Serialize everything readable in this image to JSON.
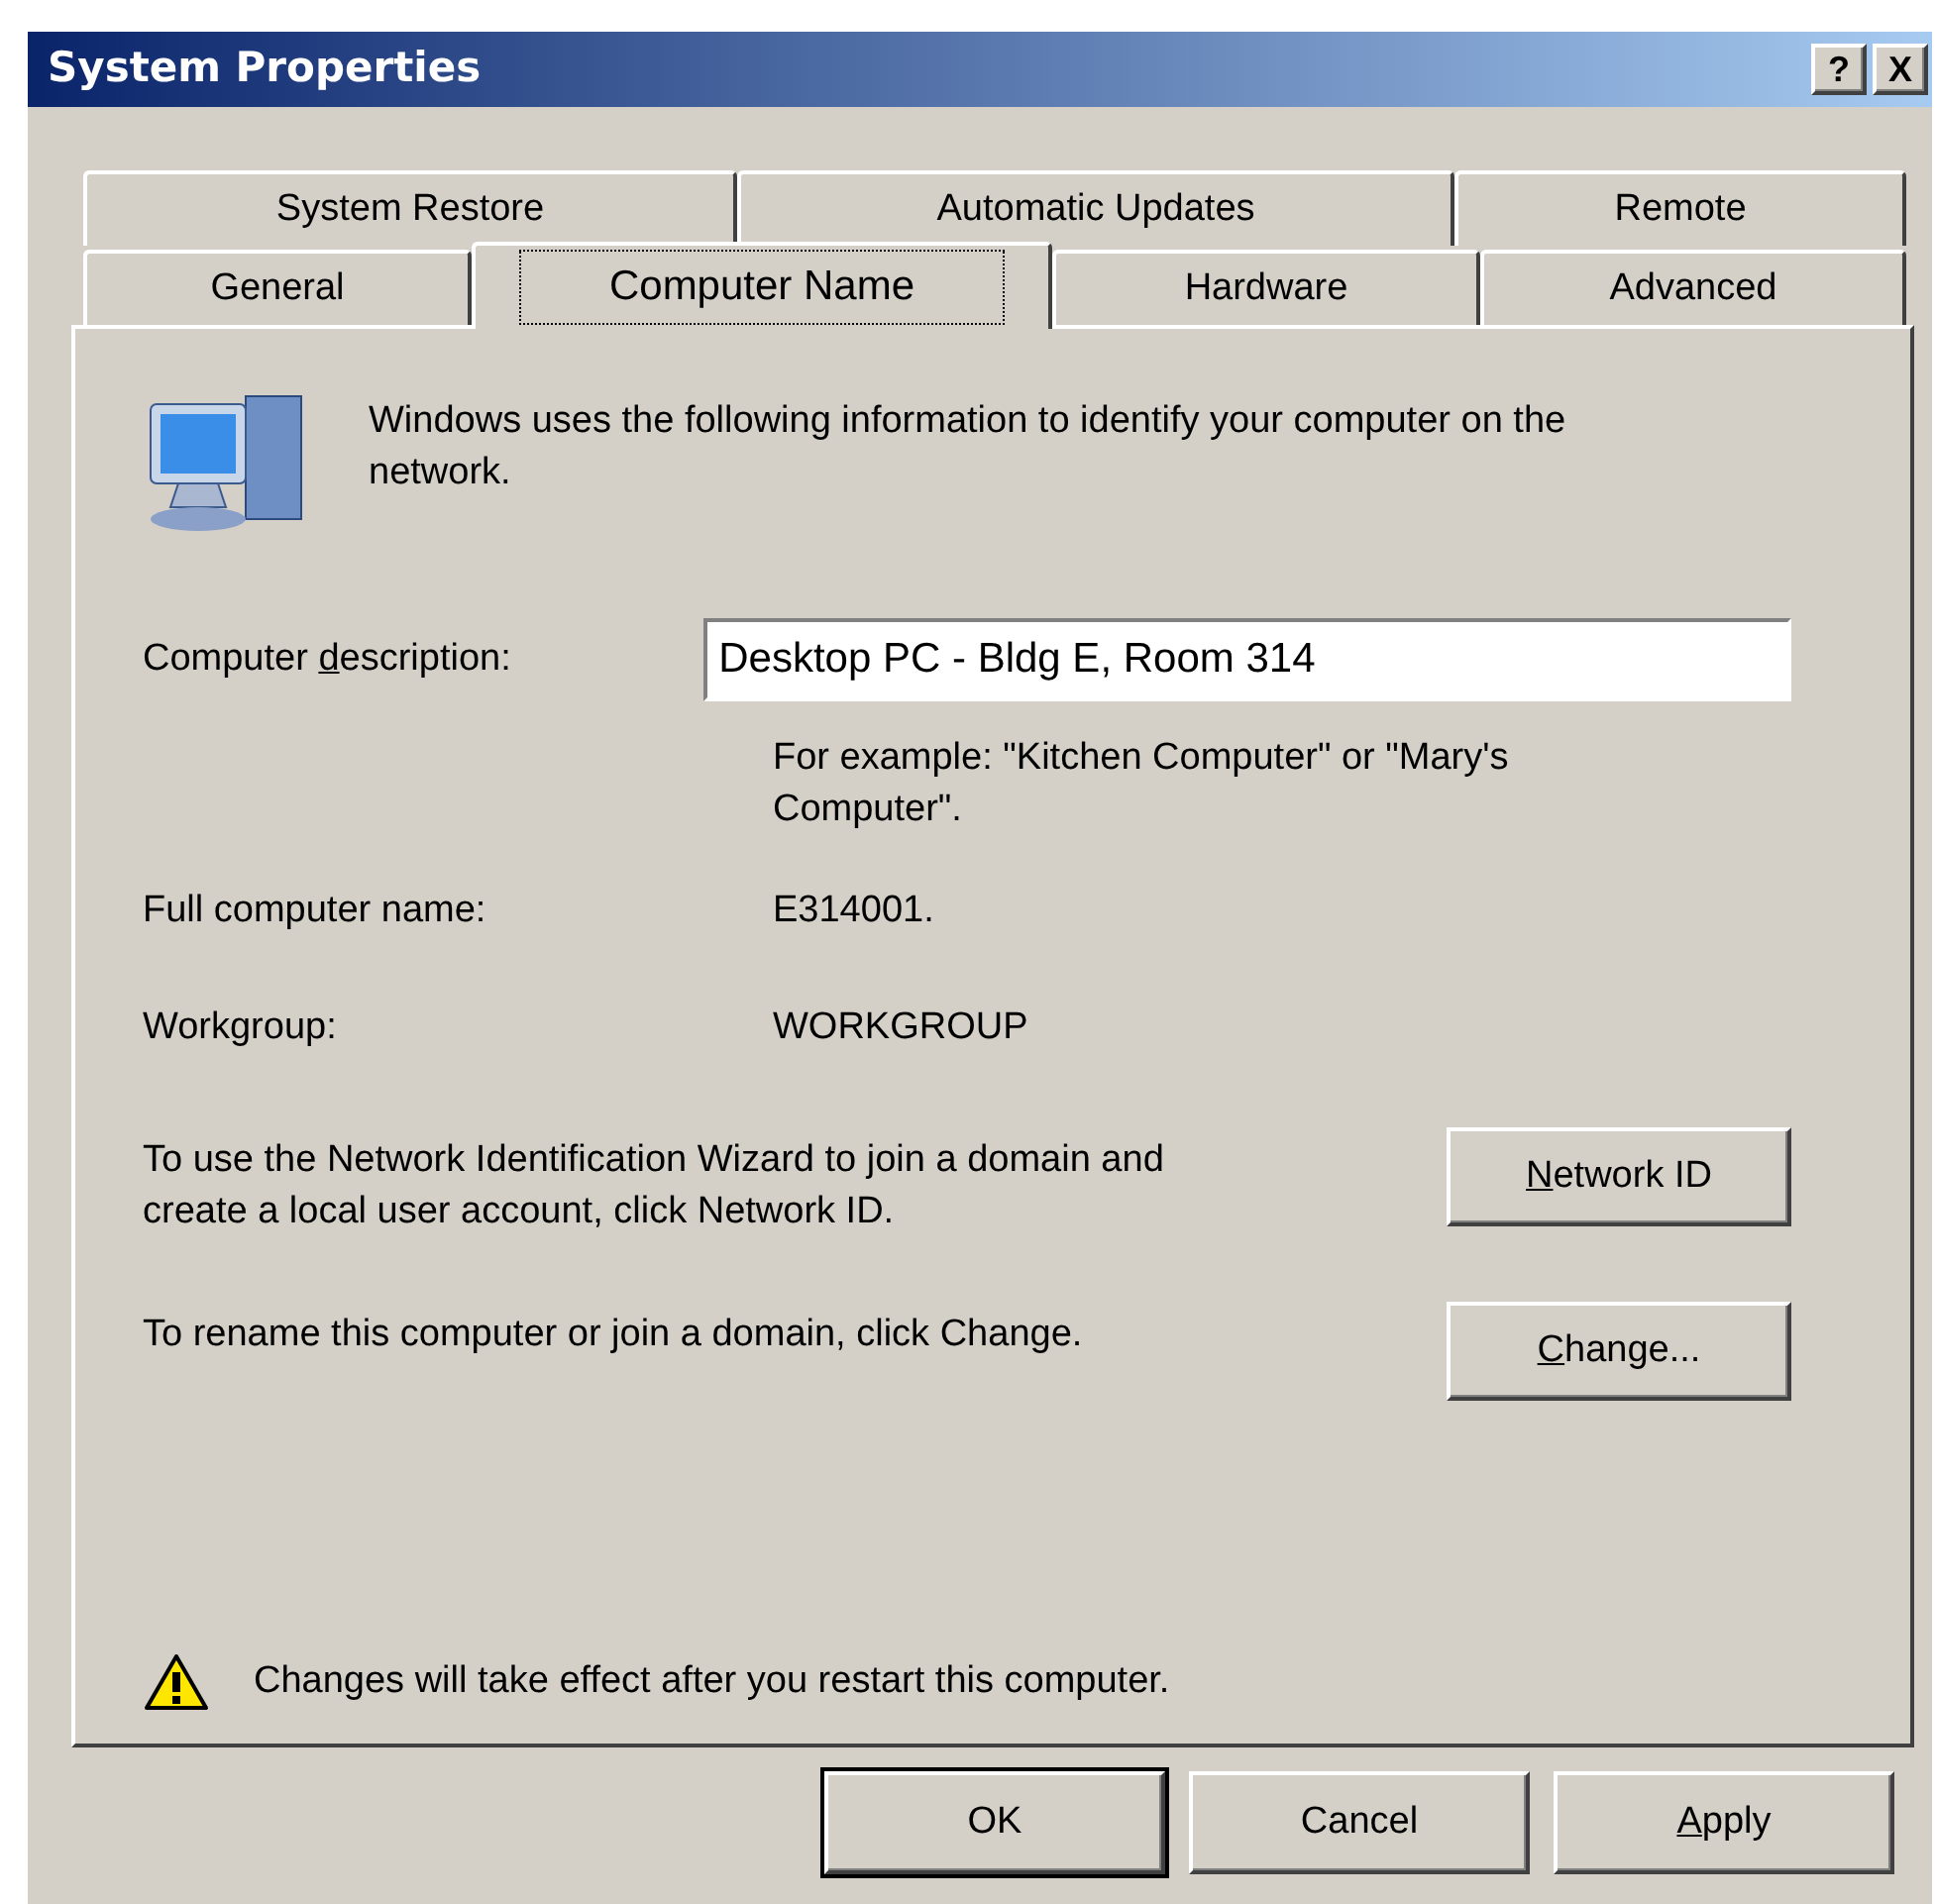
{
  "window": {
    "title": "System Properties",
    "title_buttons": [
      "?",
      "X"
    ]
  },
  "tabs": [
    [
      {
        "label": "System Restore",
        "selected": false
      },
      {
        "label": "Automatic Updates",
        "selected": false
      },
      {
        "label": "Remote",
        "selected": false
      }
    ],
    [
      {
        "label": "General",
        "selected": false
      },
      {
        "label": "Computer Name",
        "selected": true
      },
      {
        "label": "Hardware",
        "selected": false
      },
      {
        "label": "Advanced",
        "selected": false
      }
    ]
  ],
  "intro": "Windows uses the following information to identify your computer on the network.",
  "description": {
    "label": {
      "pre": "Computer ",
      "key": "d",
      "post": "escription:"
    },
    "value": "Desktop PC - Bldg E, Room 314",
    "hint": "For example: \"Kitchen Computer\" or \"Mary's Computer\"."
  },
  "info": [
    {
      "label": "Full computer name:",
      "value": "E314001."
    },
    {
      "label": "Workgroup:",
      "value": "WORKGROUP"
    }
  ],
  "actions": [
    {
      "text": "To use the Network Identification Wizard to join a domain and create a local user account, click Network ID.",
      "button": {
        "key": "N",
        "post": "etwork ID"
      }
    },
    {
      "text": "To rename this computer or join a domain, click Change.",
      "button": {
        "key": "C",
        "post": "hange..."
      }
    }
  ],
  "warning": "Changes will take effect after you restart this computer.",
  "buttons": [
    {
      "label": {
        "post": "OK"
      },
      "default": true
    },
    {
      "label": {
        "post": "Cancel"
      },
      "default": false
    },
    {
      "label": {
        "key": "A",
        "post": "pply"
      },
      "default": false
    }
  ]
}
